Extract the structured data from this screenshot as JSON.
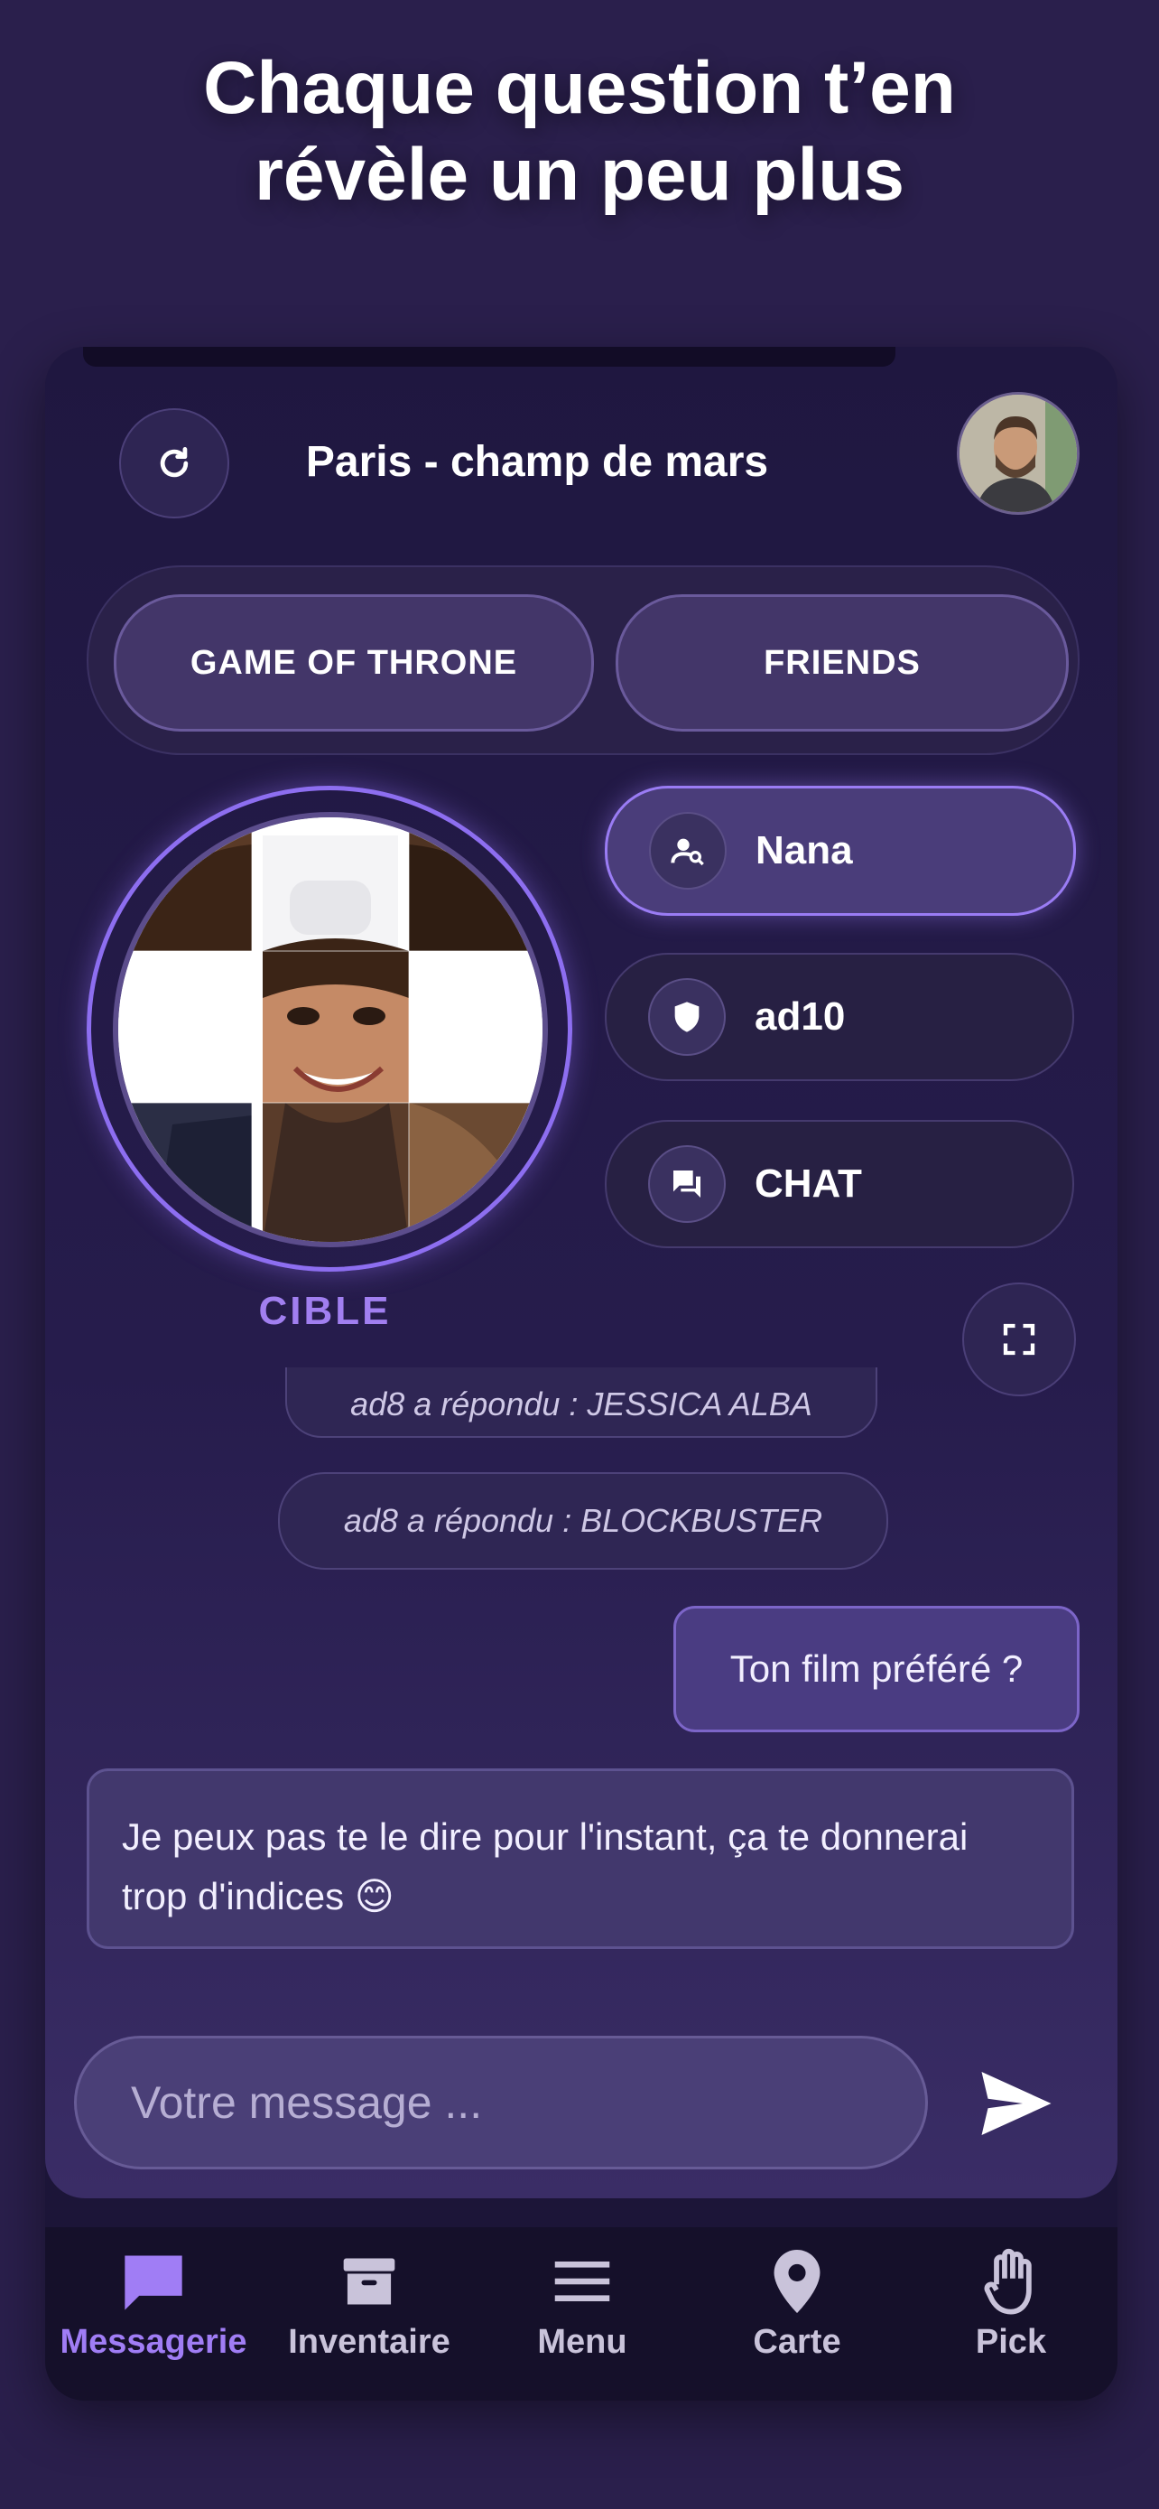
{
  "headline": {
    "line1": "Chaque question t’en",
    "line2": "révèle un peu plus"
  },
  "header": {
    "title": "Paris - champ de mars",
    "refresh_icon": "refresh-icon",
    "avatar": "user-avatar"
  },
  "tabs": [
    {
      "label": "GAME OF THRONE"
    },
    {
      "label": "FRIENDS"
    }
  ],
  "target": {
    "label": "CIBLE"
  },
  "side_pills": [
    {
      "label": "Nana",
      "icon": "person-search-icon",
      "active": true
    },
    {
      "label": "ad10",
      "icon": "shield-icon",
      "active": false
    },
    {
      "label": "CHAT",
      "icon": "chat-icon",
      "active": false
    }
  ],
  "chat": {
    "system_messages": [
      "ad8 a répondu : JESSICA ALBA",
      "ad8 a répondu : BLOCKBUSTER"
    ],
    "outgoing": "Ton film préféré ?",
    "incoming": "Je peux pas te le dire pour l'instant, ça te donnerai trop d'indices 😊"
  },
  "composer": {
    "placeholder": "Votre message ...",
    "send_icon": "send-icon"
  },
  "nav": [
    {
      "label": "Messagerie",
      "icon": "message-icon",
      "active": true
    },
    {
      "label": "Inventaire",
      "icon": "archive-icon",
      "active": false
    },
    {
      "label": "Menu",
      "icon": "menu-icon",
      "active": false
    },
    {
      "label": "Carte",
      "icon": "map-pin-icon",
      "active": false
    },
    {
      "label": "Pick",
      "icon": "hand-icon",
      "active": false
    }
  ],
  "colors": {
    "accent": "#9a7cf4",
    "background": "#2a1f4c",
    "nav_bg": "#15102a"
  }
}
